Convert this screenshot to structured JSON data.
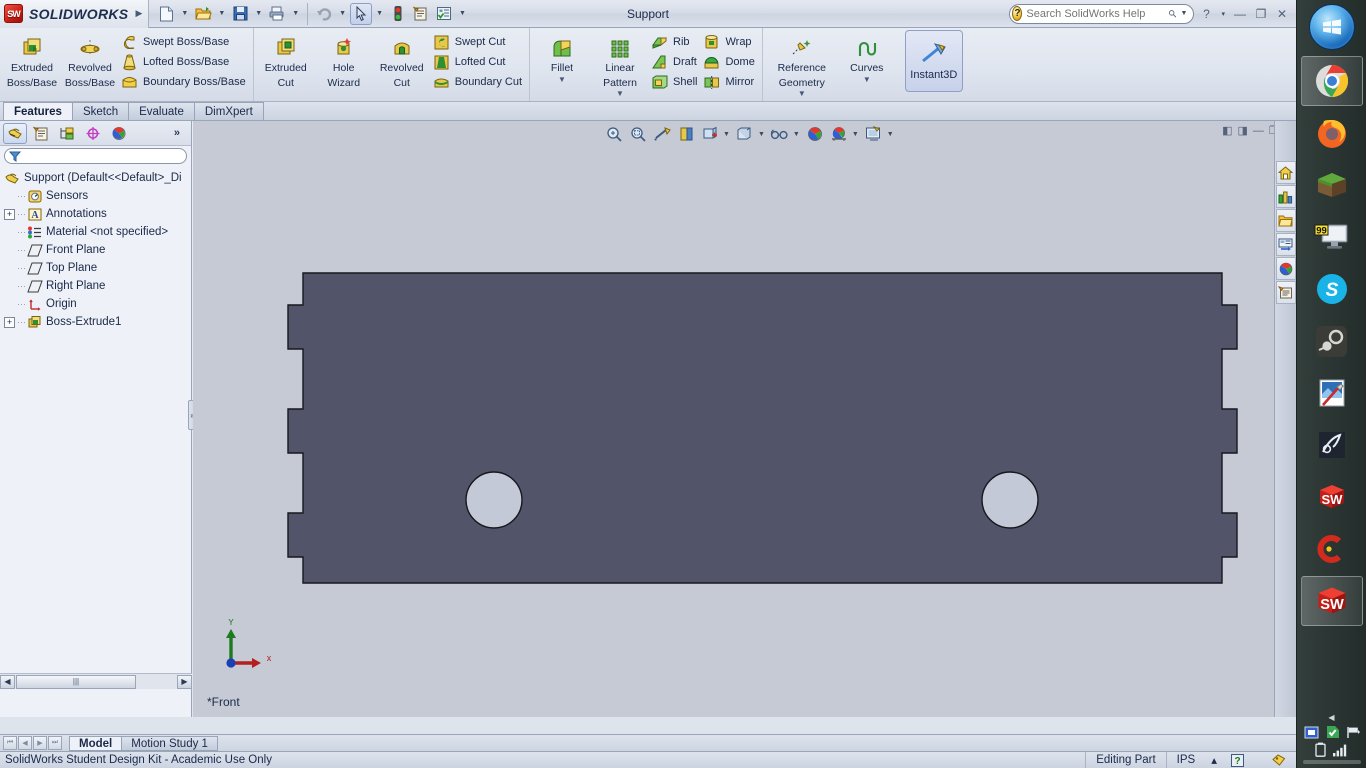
{
  "window": {
    "title": "Support",
    "app_name": "SOLIDWORKS",
    "logo_text": "SW",
    "expand_arrow": "chevron-right"
  },
  "quick_access": [
    {
      "name": "new-document",
      "icon": "new-doc-icon",
      "has_caret": true
    },
    {
      "name": "open-document",
      "icon": "open-folder-icon",
      "has_caret": true
    },
    {
      "name": "save-document",
      "icon": "save-disk-icon",
      "has_caret": true
    },
    {
      "name": "print-document",
      "icon": "printer-icon",
      "has_caret": true
    },
    {
      "name": "undo",
      "icon": "undo-arrow-icon",
      "has_caret": true
    },
    {
      "name": "select",
      "icon": "cursor-arrow-icon",
      "has_caret": true,
      "selected": true
    },
    {
      "name": "rebuild",
      "icon": "traffic-light-icon",
      "has_caret": false
    },
    {
      "name": "file-properties",
      "icon": "file-properties-icon",
      "has_caret": false
    },
    {
      "name": "options",
      "icon": "options-checklist-icon",
      "has_caret": true
    }
  ],
  "search": {
    "placeholder": "Search SolidWorks Help",
    "value": "",
    "icon": "question-mark-icon",
    "magnifier": "magnifier-icon",
    "caret": "chevron-down-icon"
  },
  "window_buttons": [
    {
      "name": "help-button",
      "glyph": "?"
    },
    {
      "name": "help-caret",
      "glyph": "▾"
    },
    {
      "name": "minimize-button",
      "glyph": "—"
    },
    {
      "name": "restore-button",
      "glyph": "❐"
    },
    {
      "name": "close-button",
      "glyph": "✕"
    }
  ],
  "ribbon": {
    "groups": [
      {
        "name": "boss-base-group",
        "big": [
          {
            "label": "Extruded\nBoss/Base",
            "label1": "Extruded",
            "label2": "Boss/Base",
            "icon": "extruded-boss-icon",
            "dropdown": false
          },
          {
            "label1": "Revolved",
            "label2": "Boss/Base",
            "icon": "revolved-boss-icon",
            "dropdown": false
          }
        ],
        "small": [
          {
            "label": "Swept Boss/Base",
            "icon": "swept-boss-icon"
          },
          {
            "label": "Lofted Boss/Base",
            "icon": "lofted-boss-icon"
          },
          {
            "label": "Boundary Boss/Base",
            "icon": "boundary-boss-icon"
          }
        ]
      },
      {
        "name": "cut-group",
        "big": [
          {
            "label1": "Extruded",
            "label2": "Cut",
            "icon": "extruded-cut-icon",
            "dropdown": false
          },
          {
            "label1": "Hole",
            "label2": "Wizard",
            "icon": "hole-wizard-icon",
            "dropdown": false
          },
          {
            "label1": "Revolved",
            "label2": "Cut",
            "icon": "revolved-cut-icon",
            "dropdown": false
          }
        ],
        "small": [
          {
            "label": "Swept Cut",
            "icon": "swept-cut-icon"
          },
          {
            "label": "Lofted Cut",
            "icon": "lofted-cut-icon"
          },
          {
            "label": "Boundary Cut",
            "icon": "boundary-cut-icon"
          }
        ]
      },
      {
        "name": "features-group",
        "big": [
          {
            "label1": "Fillet",
            "label2": "",
            "icon": "fillet-icon",
            "dropdown": true
          },
          {
            "label1": "Linear",
            "label2": "Pattern",
            "icon": "linear-pattern-icon",
            "dropdown": true
          }
        ],
        "small": [
          {
            "label": "Rib",
            "icon": "rib-icon"
          },
          {
            "label": "Draft",
            "icon": "draft-icon"
          },
          {
            "label": "Shell",
            "icon": "shell-icon"
          }
        ],
        "small2": [
          {
            "label": "Wrap",
            "icon": "wrap-icon"
          },
          {
            "label": "Dome",
            "icon": "dome-icon"
          },
          {
            "label": "Mirror",
            "icon": "mirror-icon"
          }
        ]
      },
      {
        "name": "reference-group",
        "big": [
          {
            "label1": "Reference",
            "label2": "Geometry",
            "icon": "reference-geometry-icon",
            "dropdown": true
          },
          {
            "label1": "Curves",
            "label2": "",
            "icon": "curves-icon",
            "dropdown": true
          }
        ]
      }
    ],
    "instant3d": {
      "label": "Instant3D",
      "icon": "instant3d-icon",
      "active": true
    }
  },
  "command_tabs": [
    {
      "label": "Features",
      "active": true
    },
    {
      "label": "Sketch",
      "active": false
    },
    {
      "label": "Evaluate",
      "active": false
    },
    {
      "label": "DimXpert",
      "active": false
    }
  ],
  "feature_manager": {
    "tabs": [
      {
        "name": "feature-manager-tab",
        "icon": "feature-tree-icon",
        "selected": true
      },
      {
        "name": "property-manager-tab",
        "icon": "property-manager-icon",
        "selected": false
      },
      {
        "name": "configuration-manager-tab",
        "icon": "configuration-manager-icon",
        "selected": false
      },
      {
        "name": "dimxpert-manager-tab",
        "icon": "dimxpert-manager-icon",
        "selected": false
      },
      {
        "name": "display-manager-tab",
        "icon": "display-manager-icon",
        "selected": false
      }
    ],
    "more_glyph": "»",
    "filter": {
      "placeholder": "",
      "value": "",
      "icon": "filter-funnel-icon"
    },
    "tree": [
      {
        "label": "Support  (Default<<Default>_Di",
        "icon": "part-icon",
        "indent": 0,
        "expander": "none",
        "level": "root"
      },
      {
        "label": "Sensors",
        "icon": "sensors-icon",
        "indent": 1,
        "expander": "none"
      },
      {
        "label": "Annotations",
        "icon": "annotations-icon",
        "indent": 1,
        "expander": "plus"
      },
      {
        "label": "Material <not specified>",
        "icon": "material-icon",
        "indent": 1,
        "expander": "none"
      },
      {
        "label": "Front Plane",
        "icon": "plane-icon",
        "indent": 1,
        "expander": "none"
      },
      {
        "label": "Top Plane",
        "icon": "plane-icon",
        "indent": 1,
        "expander": "none"
      },
      {
        "label": "Right Plane",
        "icon": "plane-icon",
        "indent": 1,
        "expander": "none"
      },
      {
        "label": "Origin",
        "icon": "origin-icon",
        "indent": 1,
        "expander": "none"
      },
      {
        "label": "Boss-Extrude1",
        "icon": "boss-extrude-icon",
        "indent": 1,
        "expander": "plus"
      }
    ],
    "hscroll": {
      "left_arrow": "◀",
      "right_arrow": "▶",
      "thumb_glyph": "|||"
    }
  },
  "heads_up_toolbar": [
    {
      "name": "zoom-to-fit",
      "icon": "zoom-fit-icon",
      "caret": false
    },
    {
      "name": "zoom-to-area",
      "icon": "zoom-area-icon",
      "caret": false
    },
    {
      "name": "previous-view",
      "icon": "previous-view-icon",
      "caret": false
    },
    {
      "name": "section-view",
      "icon": "section-view-icon",
      "caret": false
    },
    {
      "name": "view-orientation",
      "icon": "view-orientation-icon",
      "caret": true
    },
    {
      "name": "display-style",
      "icon": "display-style-icon",
      "caret": true
    },
    {
      "name": "hide-show-items",
      "icon": "glasses-icon",
      "caret": true
    },
    {
      "name": "edit-appearance",
      "icon": "appearance-sphere-icon",
      "caret": false
    },
    {
      "name": "apply-scene",
      "icon": "apply-scene-icon",
      "caret": true
    },
    {
      "name": "view-settings",
      "icon": "view-settings-icon",
      "caret": true
    }
  ],
  "graphics_window_buttons": [
    {
      "name": "restore-left-pane",
      "glyph": "◧"
    },
    {
      "name": "restore-right-pane",
      "glyph": "◨"
    },
    {
      "name": "minimize-document",
      "glyph": "—"
    },
    {
      "name": "restore-document",
      "glyph": "❐"
    },
    {
      "name": "close-document",
      "glyph": "✕"
    }
  ],
  "viewport": {
    "view_label": "*Front",
    "triad": {
      "x_label": "x",
      "y_label": "Y",
      "x_color": "#b42020",
      "y_color": "#1e7a1e",
      "origin_color": "#1b3fb4"
    },
    "model": {
      "name": "support-plate",
      "face_color": "#52556a",
      "edge_color": "#1a1a22",
      "hole_color": "#c3c9d6",
      "background_color": "#c5cad5"
    }
  },
  "task_pane": [
    {
      "name": "solidworks-resources",
      "icon": "home-icon"
    },
    {
      "name": "design-library",
      "icon": "design-library-icon"
    },
    {
      "name": "file-explorer",
      "icon": "folder-icon"
    },
    {
      "name": "search-pane",
      "icon": "search-pane-icon"
    },
    {
      "name": "appearances-scenes",
      "icon": "appearances-sphere-icon"
    },
    {
      "name": "custom-properties",
      "icon": "custom-properties-icon"
    }
  ],
  "bottom_tabs": {
    "nav": [
      "⏮",
      "◀",
      "▶",
      "⏭"
    ],
    "tabs": [
      {
        "label": "Model",
        "active": true
      },
      {
        "label": "Motion Study 1",
        "active": false
      }
    ]
  },
  "status_bar": {
    "left": "SolidWorks Student Design Kit - Academic Use Only",
    "editing": "Editing Part",
    "units": "IPS",
    "units_caret": "▴",
    "help": "?",
    "tag_icon": "tag-icon"
  },
  "taskbar": {
    "start": {
      "name": "start-orb",
      "icon": "windows-logo-icon"
    },
    "items": [
      {
        "name": "taskbar-chrome",
        "icon": "chrome-icon",
        "active": true
      },
      {
        "name": "taskbar-firefox",
        "icon": "firefox-icon",
        "active": false
      },
      {
        "name": "taskbar-minecraft",
        "icon": "minecraft-icon",
        "active": false
      },
      {
        "name": "taskbar-monitor-99",
        "icon": "monitor-99-icon",
        "active": false,
        "badge": "99"
      },
      {
        "name": "taskbar-skype",
        "icon": "skype-icon",
        "active": false
      },
      {
        "name": "taskbar-steam",
        "icon": "steam-icon",
        "active": false
      },
      {
        "name": "taskbar-paint",
        "icon": "paint-icon",
        "active": false
      },
      {
        "name": "taskbar-wacom",
        "icon": "wacom-icon",
        "active": false
      },
      {
        "name": "taskbar-solidworks-1",
        "icon": "solidworks-cube-icon",
        "active": false
      },
      {
        "name": "taskbar-cdot",
        "icon": "cdot-icon",
        "active": false
      },
      {
        "name": "taskbar-solidworks-2",
        "icon": "solidworks-cube-icon",
        "active": true
      }
    ],
    "tray": [
      {
        "name": "tray-expand",
        "icon": "tray-expand-icon"
      },
      {
        "name": "tray-display",
        "icon": "display-tray-icon"
      },
      {
        "name": "tray-security",
        "icon": "security-shield-icon"
      },
      {
        "name": "tray-action-center",
        "icon": "flag-icon"
      },
      {
        "name": "tray-battery",
        "icon": "battery-icon"
      },
      {
        "name": "tray-network",
        "icon": "network-bars-icon"
      }
    ]
  }
}
